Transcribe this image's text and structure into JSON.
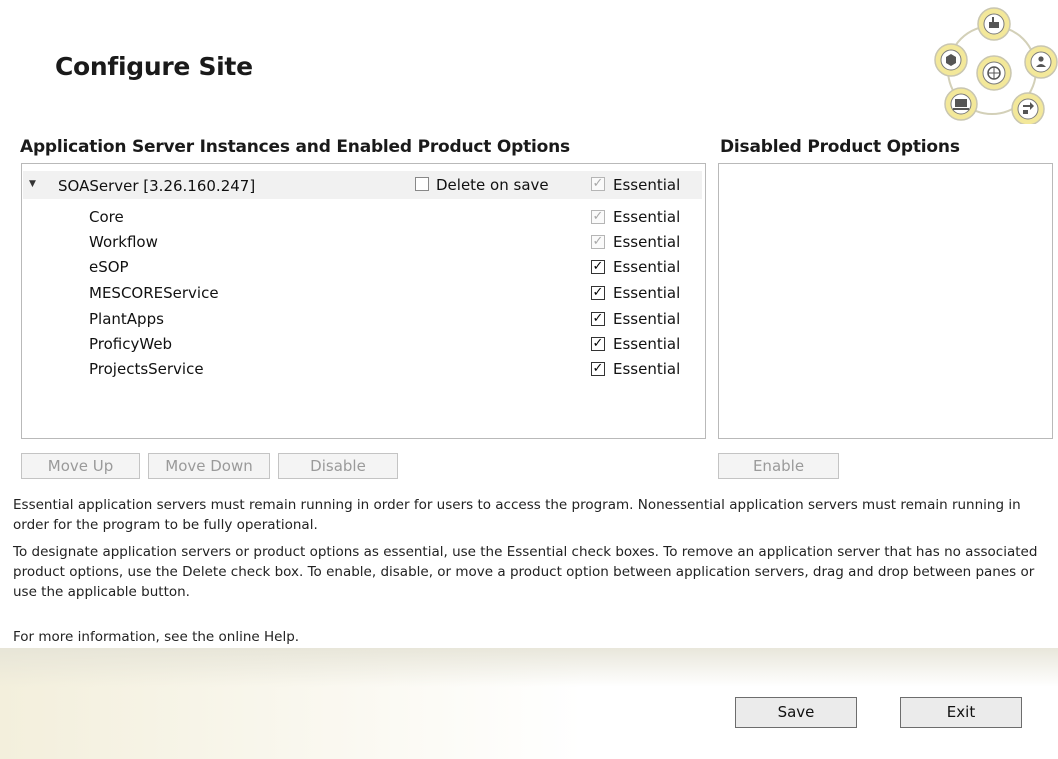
{
  "page": {
    "title": "Configure Site"
  },
  "panes": {
    "enabled_heading": "Application Server Instances and Enabled Product Options",
    "disabled_heading": "Disabled Product Options"
  },
  "server": {
    "name": "SOAServer [3.26.160.247]",
    "delete_label": "Delete on save",
    "delete_checked": false,
    "essential_label": "Essential",
    "essential_checked": true
  },
  "options": [
    {
      "name": "Core",
      "essential_label": "Essential",
      "checked": true,
      "enabled": false
    },
    {
      "name": "Workflow",
      "essential_label": "Essential",
      "checked": true,
      "enabled": false
    },
    {
      "name": "eSOP",
      "essential_label": "Essential",
      "checked": true,
      "enabled": true
    },
    {
      "name": "MESCOREService",
      "essential_label": "Essential",
      "checked": true,
      "enabled": true
    },
    {
      "name": "PlantApps",
      "essential_label": "Essential",
      "checked": true,
      "enabled": true
    },
    {
      "name": "ProficyWeb",
      "essential_label": "Essential",
      "checked": true,
      "enabled": true
    },
    {
      "name": "ProjectsService",
      "essential_label": "Essential",
      "checked": true,
      "enabled": true
    }
  ],
  "buttons": {
    "move_up": "Move Up",
    "move_down": "Move Down",
    "disable": "Disable",
    "enable": "Enable",
    "save": "Save",
    "exit": "Exit"
  },
  "info": {
    "p1": "Essential application servers must remain running in order for users to access the program. Nonessential application servers must remain running in order for the program to be fully operational.",
    "p2": "To designate application servers or product options as essential, use the Essential check boxes. To remove an application server that has no associated product options, use the Delete check box. To enable, disable, or move a product option between application servers, drag and drop between panes or use the applicable button.",
    "p3": "For more information, see the online Help."
  },
  "colors": {
    "logo_yellow": "#f3e89a",
    "logo_ring": "#c9c6b0",
    "footer_tint": "#f3efdc"
  },
  "icons": {
    "logo": "product-hub-logo",
    "expand": "expand-arrow-icon",
    "check": "check-icon"
  }
}
